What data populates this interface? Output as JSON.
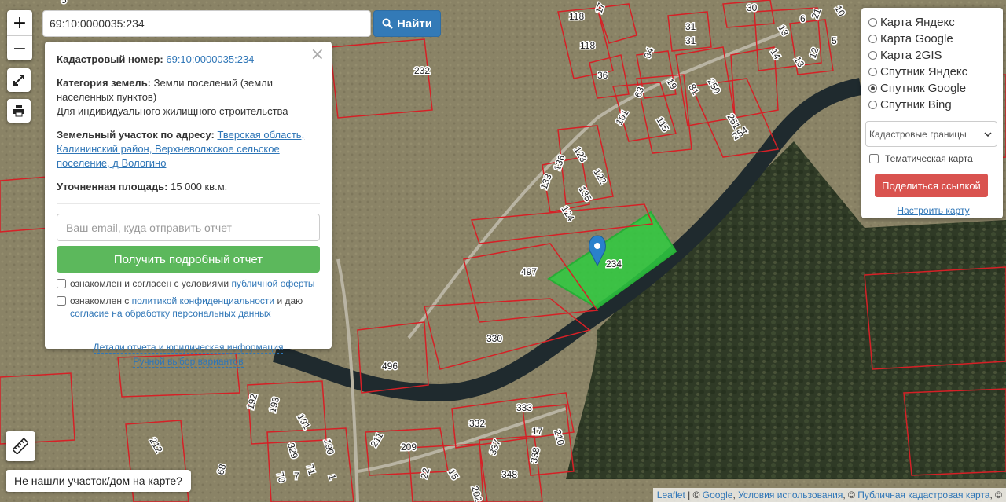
{
  "search": {
    "value": "69:10:0000035:234",
    "button_label": "Найти"
  },
  "zoom": {
    "in_label": "+",
    "out_label": "−"
  },
  "info_panel": {
    "cadastral_label": "Кадастровый номер:",
    "cadastral_number": "69:10:0000035:234",
    "category_label": "Категория земель:",
    "category_value": "Земли поселений (земли населенных пунктов)",
    "usage": "Для индивидуального жилищного строительства",
    "address_label": "Земельный участок по адресу:",
    "address_value": "Тверская область, Калининский район, Верхневолжское сельское поселение, д Вологино",
    "area_label": "Уточненная площадь:",
    "area_value": "15 000 кв.м.",
    "email_placeholder": "Ваш email, куда отправить отчет",
    "report_button": "Получить подробный отчет",
    "agree1_text": "ознакомлен и согласен с условиями ",
    "agree1_link": "публичной оферты",
    "agree2_text": "ознакомлен с ",
    "agree2_link": "политикой конфиденциальности",
    "agree2_mid": " и даю ",
    "agree2_link2": "согласие на обработку персональных данных",
    "details_link": "Детали отчета и юридическая информация",
    "manual_link": "Ручной выбор вариантов"
  },
  "layers_panel": {
    "base_layers": [
      {
        "label": "Карта Яндекс",
        "selected": false
      },
      {
        "label": "Карта Google",
        "selected": false
      },
      {
        "label": "Карта 2GIS",
        "selected": false
      },
      {
        "label": "Спутник Яндекс",
        "selected": false
      },
      {
        "label": "Спутник Google",
        "selected": true
      },
      {
        "label": "Спутник Bing",
        "selected": false
      }
    ],
    "overlay_select": "Кадастровые границы",
    "thematic_label": "Тематическая карта",
    "share_button": "Поделиться ссылкой",
    "configure_link": "Настроить карту"
  },
  "not_found": "Не нашли участок/дом на карте?",
  "attribution": {
    "leaflet": "Leaflet",
    "sep1": " | © ",
    "google": "Google",
    "sep2": ", ",
    "terms": "Условия использования",
    "sep3": ", © ",
    "pkk": "Публичная кадастровая карта",
    "sep4": ", © "
  },
  "plots": [
    "118",
    "17",
    "31",
    "30",
    "6",
    "10",
    "232",
    "118",
    "31",
    "34",
    "13",
    "21",
    "14",
    "13",
    "12",
    "5",
    "36",
    "19",
    "81",
    "250",
    "251",
    "254",
    "63",
    "115",
    "101",
    "123",
    "136",
    "122",
    "133",
    "135",
    "124",
    "497",
    "234",
    "330",
    "496",
    "192",
    "193",
    "191",
    "333",
    "332",
    "17",
    "210",
    "211",
    "209",
    "337",
    "338",
    "212",
    "329",
    "190",
    "71",
    "70",
    "7",
    "1",
    "348",
    "68",
    "22",
    "15",
    "202",
    "5"
  ],
  "colors": {
    "plot_border": "#d62026",
    "selected_fill": "#2ecc40",
    "marker": "#2a81cb"
  }
}
